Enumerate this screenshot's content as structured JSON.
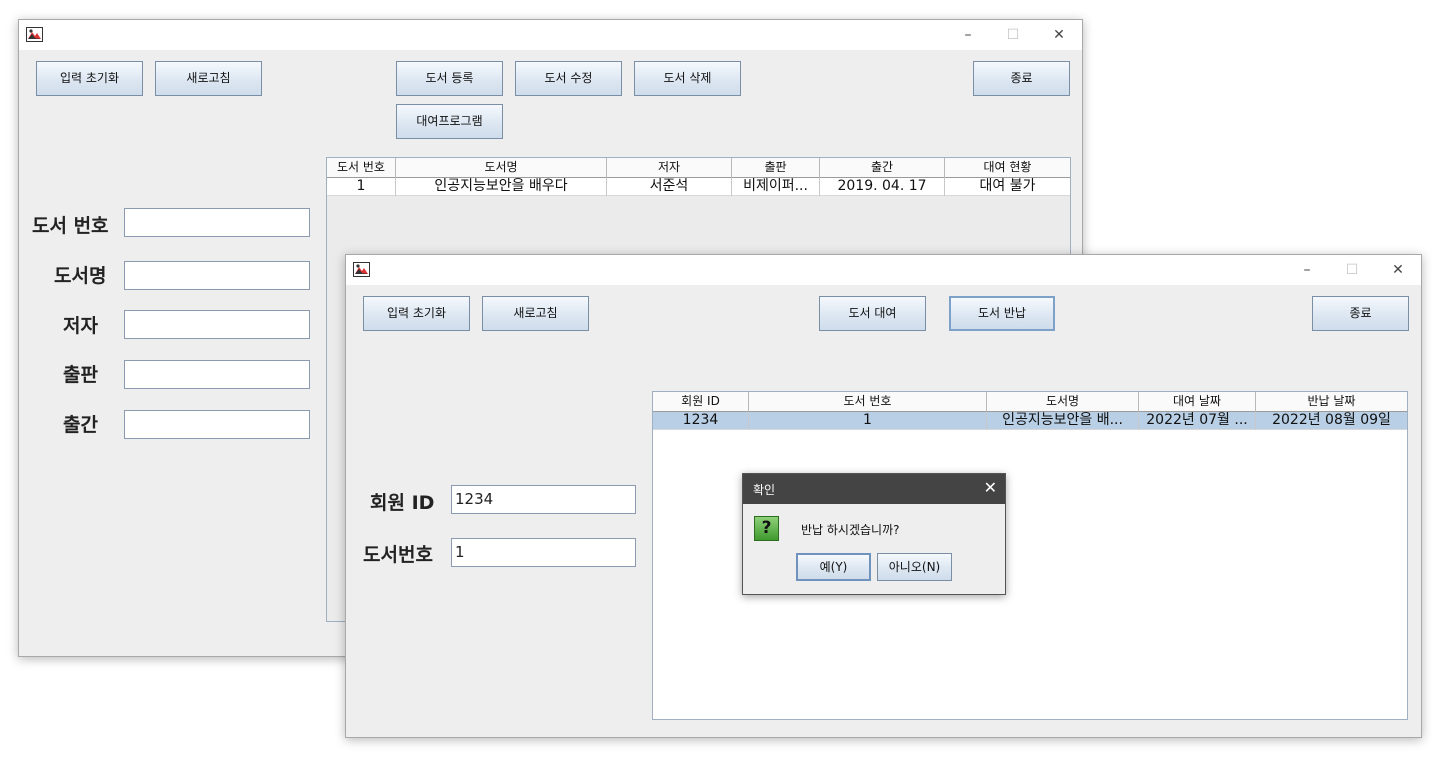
{
  "window1": {
    "buttons": {
      "reset": "입력 초기화",
      "refresh": "새로고침",
      "register": "도서 등록",
      "modify": "도서 수정",
      "delete": "도서 삭제",
      "rental_program": "대여프로그램",
      "exit": "종료"
    },
    "labels": {
      "book_no": "도서 번호",
      "title": "도서명",
      "author": "저자",
      "publisher": "출판",
      "published": "출간"
    },
    "table": {
      "columns": [
        "도서 번호",
        "도서명",
        "저자",
        "출판",
        "출간",
        "대여 현황"
      ],
      "rows": [
        [
          "1",
          "인공지능보안을 배우다",
          "서준석",
          "비제이퍼...",
          "2019. 04. 17",
          "대여 불가"
        ]
      ]
    }
  },
  "window2": {
    "buttons": {
      "reset": "입력 초기화",
      "refresh": "새로고침",
      "rent": "도서 대여",
      "return": "도서 반납",
      "exit": "종료"
    },
    "labels": {
      "member_id": "회원 ID",
      "book_no": "도서번호"
    },
    "fields": {
      "member_id": "1234",
      "book_no": "1"
    },
    "table": {
      "columns": [
        "회원 ID",
        "도서 번호",
        "도서명",
        "대여 날짜",
        "반납 날짜"
      ],
      "rows": [
        [
          "1234",
          "1",
          "인공지능보안을 배...",
          "2022년 07월 ...",
          "2022년 08월 09일"
        ]
      ]
    }
  },
  "dialog": {
    "title": "확인",
    "message": "반납 하시겠습니까?",
    "yes": "예(Y)",
    "no": "아니오(N)"
  },
  "colors": {
    "selected_row": "#b8cfe5",
    "dialog_titlebar": "#444444",
    "window_bg": "#eeeeee"
  }
}
